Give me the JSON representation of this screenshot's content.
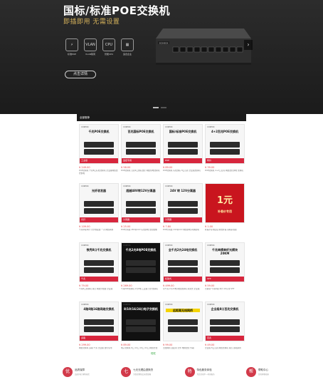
{
  "banner": {
    "title": "国标/标准POE交换机",
    "subtitle": "即插即用 无需设置",
    "features": [
      {
        "icon": "poe-plug-icon",
        "glyph": "⚡",
        "label": "标准POE"
      },
      {
        "icon": "vlan-icon",
        "glyph": "VLAN",
        "label": "VLAN隔离"
      },
      {
        "icon": "cpu-icon",
        "glyph": "CPU",
        "label": "智能CPU"
      },
      {
        "icon": "enterprise-icon",
        "glyph": "▦",
        "label": "适合企业"
      }
    ],
    "detail_button": "点击详情",
    "switch_label": "SCOKEOK",
    "next_arrow": "›"
  },
  "products": {
    "header": "全部推荐",
    "items": [
      {
        "brand": "COKEOK",
        "name": "千兆POE交换机",
        "price": "¥ 249.00",
        "desc": "POE交换机 千兆8口标准交换机 企业级网络监控供电",
        "style": "normal",
        "tag": "工业级"
      },
      {
        "brand": "COKEOK",
        "name": "百兆国标POE交换机",
        "price": "¥ 58.00",
        "desc": "POE交换机 百兆4口国标监控 网络供电交换机",
        "style": "normal",
        "tag": "监控专用"
      },
      {
        "brand": "COKEOK",
        "name": "国标/标准POE交换机",
        "price": "¥ 89.00",
        "desc": "POE交换机 标准国标 8口百兆 企业级交换机",
        "style": "normal",
        "tag": "POE"
      },
      {
        "brand": "COKEOK",
        "name": "4+2百兆POE交换机",
        "price": "¥ 39.00",
        "desc": "POE交换机 4+2口百兆 网络监控供电 交换机",
        "style": "normal",
        "tag": "特价"
      },
      {
        "brand": "COKEOK",
        "name": "光纤收发器",
        "price": "¥ 109.00",
        "desc": "千兆单模单纤 光纤收发器 一对 网络转换",
        "style": "normal",
        "tag": "光纤"
      },
      {
        "brand": "COKEOK",
        "name": "超越48V转12V分离器",
        "price": "¥ 25.00",
        "desc": "POE分离器 48V转12V 标准供电 监控摄像",
        "style": "normal",
        "tag": "分离器"
      },
      {
        "brand": "COKEOK",
        "name": "24V 转 12V分离器",
        "price": "¥ 7.80",
        "desc": "POE分离器 24V转12V 网络供电 转换模块",
        "style": "normal",
        "tag": "分离器"
      },
      {
        "brand": "",
        "name": "补差价专用",
        "big": "1元",
        "price": "¥ 1.00",
        "desc": "补差价专用链接 邮费补差 请联系客服",
        "style": "red",
        "tag": ""
      },
      {
        "brand": "COKEOK",
        "name": "铁壳8口千兆交换机",
        "price": "¥ 79.00",
        "desc": "千兆8口交换机 铁壳 网络分线器 企业级",
        "style": "normal",
        "tag": "千兆"
      },
      {
        "brand": "COKEOK",
        "name": "千兆2光8电POE交换机",
        "price": "¥ 269.00",
        "desc": "千兆POE交换机 2光8电 工业级 光纤交换机",
        "style": "dark",
        "tag": ""
      },
      {
        "brand": "COKEOK",
        "name": "全千兆2光24电交换机",
        "price": "¥ 499.00",
        "desc": "全千兆 2光24电 网络交换机 机架式 企业级",
        "style": "normal",
        "tag": "机架式"
      },
      {
        "brand": "COKEOK",
        "name": "千兆单模单纤光模块20KM",
        "price": "¥ 59.00",
        "desc": "光模块 千兆单模 单纤 20公里 SFP",
        "style": "normal",
        "tag": "SFP"
      },
      {
        "brand": "COKEOK",
        "name": "4路8路16路网络交换机",
        "price": "¥ 299.00",
        "desc": "网络交换机 多路 千兆 企业级 监控专用",
        "style": "normal",
        "tag": "多路"
      },
      {
        "brand": "COKEOK",
        "name": "8/10/16/24口电子交换机",
        "price": "¥ 89.00",
        "desc": "电子交换机 8口 10口 16口 24口 网络分线",
        "style": "dark",
        "tag": ""
      },
      {
        "brand": "COKEOK",
        "name": "远距离无线网桥",
        "price": "¥ 99.00",
        "desc": "无线网桥 远距离 室外 电梯监控 传输",
        "style": "yellow",
        "tag": ""
      },
      {
        "brand": "COKEOK",
        "name": "企业级8口百兆交换机",
        "price": "¥ 49.00",
        "desc": "企业级 8口百兆 网络交换机 铁壳 即插即用",
        "style": "normal",
        "tag": "百兆"
      }
    ]
  },
  "footer": {
    "logo_label": "旺旺",
    "services": [
      {
        "glyph": "优",
        "title": "品质保障",
        "sub": "品质护航 购物无忧"
      },
      {
        "glyph": "七",
        "title": "七天无理由退换货",
        "sub": "为您提供售后无忧保障"
      },
      {
        "glyph": "特",
        "title": "特色服务体验",
        "sub": "为您呈现不一样的服务"
      },
      {
        "glyph": "帮",
        "title": "帮助中心",
        "sub": "您的购物指南"
      }
    ]
  },
  "colors": {
    "accent_red": "#d23a4a",
    "price_red": "#e4393c",
    "banner_gold": "#d4b15a"
  }
}
